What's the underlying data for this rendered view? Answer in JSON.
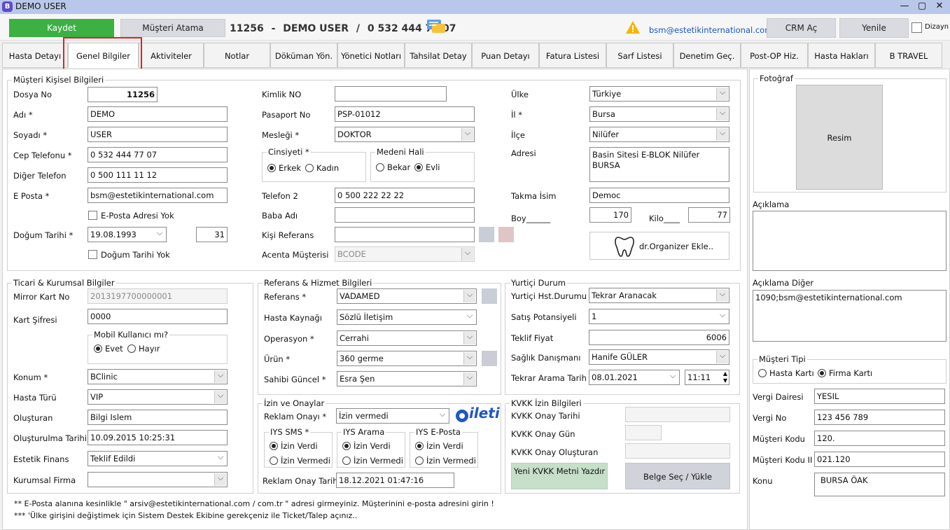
{
  "window": {
    "title": "DEMO USER",
    "icon": "B"
  },
  "toolbar": {
    "save": "Kaydet",
    "assign": "Müşteri Atama",
    "patient_no": "11256",
    "sep1": "-",
    "patient_name": "DEMO USER",
    "sep2": "/",
    "patient_phone": "0 532 444 77 07",
    "email": "bsm@estetikinternational.com",
    "crm": "CRM Aç",
    "refresh": "Yenile",
    "design": "Dizayn"
  },
  "tabs": [
    "Hasta Detayı",
    "Genel Bilgiler",
    "Aktiviteler",
    "Notlar",
    "Döküman Yön.",
    "Yönetici Notları",
    "Tahsilat Detay",
    "Puan Detayı",
    "Fatura Listesi",
    "Sarf Listesi",
    "Denetim Geç.",
    "Post-OP Hiz.",
    "Hasta Hakları",
    "B TRAVEL"
  ],
  "personal": {
    "legend": "Müşteri Kişisel Bilgileri",
    "dosya_no_label": "Dosya No",
    "dosya_no": "11256",
    "adi_label": "Adı *",
    "adi": "DEMO",
    "soyadi_label": "Soyadı *",
    "soyadi": "USER",
    "cep_label": "Cep Telefonu *",
    "cep": "0 532 444 77 07",
    "diger_tel_label": "Diğer Telefon",
    "diger_tel": "0 500 111 11 12",
    "eposta_label": "E Posta *",
    "eposta": "bsm@estetikinternational.com",
    "eposta_yok": "E-Posta Adresi Yok",
    "dogum_label": "Doğum Tarihi *",
    "dogum": "19.08.1993",
    "yas": "31",
    "dogum_yok": "Doğum Tarihi Yok",
    "kimlik_label": "Kimlik NO",
    "kimlik": "",
    "pasaport_label": "Pasaport No",
    "pasaport": "PSP-01012",
    "meslek_label": "Mesleği *",
    "meslek": "DOKTOR",
    "cinsiyet_legend": "Cinsiyeti  *",
    "erkek": "Erkek",
    "kadin": "Kadın",
    "medeni_legend": "Medeni Hali",
    "bekar": "Bekar",
    "evli": "Evli",
    "tel2_label": "Telefon 2",
    "tel2": "0 500 222 22 22",
    "baba_label": "Baba Adı",
    "baba": "",
    "kisi_ref_label": "Kişi Referans",
    "kisi_ref": "",
    "acenta_label": "Acenta Müşterisi",
    "acenta": "BCODE",
    "ulke_label": "Ülke",
    "ulke": "Türkiye",
    "il_label": "İl *",
    "il": "Bursa",
    "ilce_label": "İlçe",
    "ilce": "Nilüfer",
    "adres_label": "Adresi",
    "adres": "Basin Sitesi E-BLOK Nilüfer BURSA",
    "takma_label": "Takma İsim",
    "takma": "Democ",
    "boy_label": "Boy______",
    "boy": "170",
    "kilo_label": "Kilo____",
    "kilo": "77",
    "organizer": "dr.Organizer Ekle.."
  },
  "commercial": {
    "legend": "Ticari & Kurumsal Bilgiler",
    "mirror_label": "Mirror Kart No",
    "mirror": "2013197700000001",
    "sifre_label": "Kart Şifresi",
    "sifre": "0000",
    "mobil_legend": "Mobil Kullanıcı mı?",
    "evet": "Evet",
    "hayir": "Hayır",
    "konum_label": "Konum *",
    "konum": "BClinic",
    "tur_label": "Hasta Türü",
    "tur": "VIP",
    "olusturan_label": "Oluşturan",
    "olusturan": "Bilgi Islem",
    "olus_tarih_label": "Oluşturulma Tarihi",
    "olus_tarih": "10.09.2015 10:25:31",
    "finans_label": "Estetik Finans",
    "finans": "Teklif Edildi",
    "firma_label": "Kurumsal Firma",
    "firma": ""
  },
  "reference": {
    "legend": "Referans  & Hizmet Bilgileri",
    "ref_label": "Referans *",
    "ref": "VADAMED",
    "kaynak_label": "Hasta Kaynağı",
    "kaynak": "Sözlü İletişim",
    "operasyon_label": "Operasyon *",
    "operasyon": "Cerrahi",
    "urun_label": "Ürün *",
    "urun": "360 germe",
    "sahibi_label": "Sahibi Güncel *",
    "sahibi": "Esra Şen"
  },
  "domestic": {
    "legend": "Yurtiçi Durum",
    "hst_label": "Yurtiçi Hst.Durumu",
    "hst": "Tekrar Aranacak",
    "satis_label": "Satış Potansiyeli",
    "satis": "1",
    "teklif_label": "Teklif Fiyat",
    "teklif": "6006",
    "danisman_label": "Sağlık Danışmanı",
    "danisman": "Hanife GÜLER",
    "tekrar_label": "Tekrar Arama Tarih",
    "tekrar_tarih": "08.01.2021",
    "tekrar_saat": "11:11"
  },
  "permissions": {
    "legend": "İzin ve Onaylar",
    "reklam_label": "Reklam Onayı *",
    "reklam": "İzin vermedi",
    "ileti_logo": "ileti",
    "sms_legend": "IYS SMS *",
    "arama_legend": "IYS Arama",
    "eposta_legend": "IYS E-Posta",
    "izin_verdi": "İzin Verdi",
    "izin_vermedi": "İzin Vermedi",
    "reklam_tarih_label": "Reklam Onay Tarihi",
    "reklam_tarih": "18.12.2021 01:47:16"
  },
  "kvkk": {
    "legend": "KVKK İzin Bilgileri",
    "tarih_label": "KVKK Onay Tarihi",
    "gun_label": "KVKK Onay Gün",
    "olusturan_label": "KVKK Onay Oluşturan",
    "yeni_btn": "Yeni KVKK Metni Yazdır",
    "belge_btn": "Belge Seç / Yükle"
  },
  "side": {
    "foto_legend": "Fotoğraf",
    "resim": "Resim",
    "aciklama_label": "Açıklama",
    "aciklama": "",
    "aciklama_diger_label": "Açıklama Diğer",
    "aciklama_diger": "1090;bsm@estetikinternational.com",
    "tip_legend": "Müşteri Tipi",
    "hasta_karti": "Hasta Kartı",
    "firma_karti": "Firma Kartı",
    "vergi_dairesi_label": "Vergi Dairesi",
    "vergi_dairesi": "YESIL",
    "vergi_no_label": "Vergi No",
    "vergi_no": "123 456 789",
    "musteri_kodu_label": "Müşteri Kodu",
    "musteri_kodu": "120.",
    "musteri_kodu2_label": "Müşteri Kodu II",
    "musteri_kodu2": "021.120",
    "konu_label": "Konu",
    "konu": "BURSA ÖAK"
  },
  "notes": {
    "n1": "** E-Posta alanına kesinlikle \" arsiv@estetikinternational.com / com.tr \" adresi girmeyiniz. Müşterinini e-posta adresini girin !",
    "n2": "*** 'Ülke girişini değiştimek için Sistem Destek Ekibine gerekçeniz ile Ticket/Talep açınız.."
  },
  "colors": {
    "save": "#3cb043",
    "highlight": "#e02020",
    "email": "#1a56c6"
  }
}
